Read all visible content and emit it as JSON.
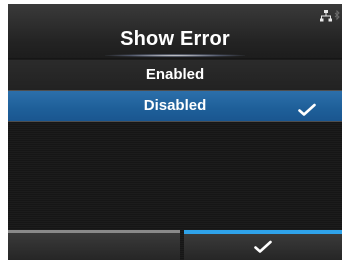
{
  "screen": {
    "title": "Show Error",
    "status_icons": [
      "network-icon",
      "bluetooth-icon"
    ]
  },
  "menu": {
    "items": [
      {
        "label": "Enabled",
        "selected": false,
        "checked": false
      },
      {
        "label": "Disabled",
        "selected": true,
        "checked": true
      }
    ]
  },
  "footer": {
    "left_key": {
      "label": "",
      "icon": ""
    },
    "right_key": {
      "label": "",
      "icon": "checkmark-icon"
    }
  },
  "colors": {
    "selected_row": "#1e5f99",
    "accent_softkey": "#2fa3ea",
    "background": "#1a1a1a"
  }
}
